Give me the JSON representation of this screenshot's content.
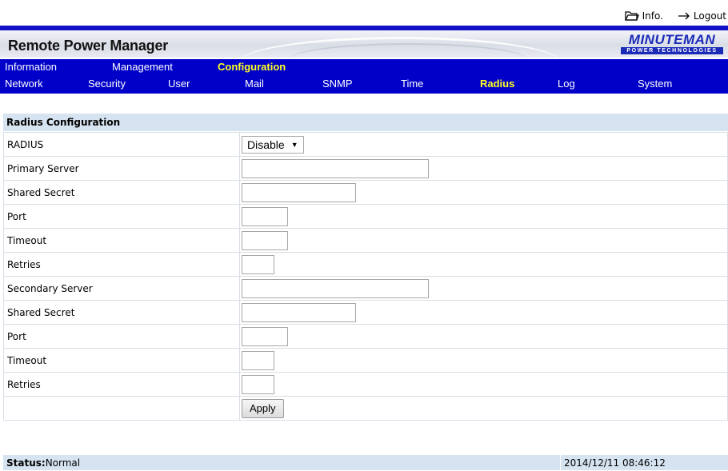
{
  "toplinks": {
    "info_label": "Info.",
    "logout_label": "Logout"
  },
  "app": {
    "title": "Remote Power Manager",
    "logo_main": "MINUTEMAN",
    "logo_sub": "POWER TECHNOLOGIES"
  },
  "nav_primary": [
    {
      "label": "Information",
      "active": false
    },
    {
      "label": "Management",
      "active": false
    },
    {
      "label": "Configuration",
      "active": true
    }
  ],
  "nav_secondary": [
    {
      "label": "Network",
      "active": false
    },
    {
      "label": "Security",
      "active": false
    },
    {
      "label": "User",
      "active": false
    },
    {
      "label": "Mail",
      "active": false
    },
    {
      "label": "SNMP",
      "active": false
    },
    {
      "label": "Time",
      "active": false
    },
    {
      "label": "Radius",
      "active": true
    },
    {
      "label": "Log",
      "active": false
    },
    {
      "label": "System",
      "active": false
    }
  ],
  "form": {
    "title": "Radius Configuration",
    "radius_label": "RADIUS",
    "radius_value": "Disable",
    "fields": [
      {
        "label": "Primary Server",
        "value": ""
      },
      {
        "label": "Shared Secret",
        "value": ""
      },
      {
        "label": "Port",
        "value": ""
      },
      {
        "label": "Timeout",
        "value": ""
      },
      {
        "label": "Retries",
        "value": ""
      },
      {
        "label": "Secondary Server",
        "value": ""
      },
      {
        "label": "Shared Secret",
        "value": ""
      },
      {
        "label": "Port",
        "value": ""
      },
      {
        "label": "Timeout",
        "value": ""
      },
      {
        "label": "Retries",
        "value": ""
      }
    ],
    "apply_label": "Apply"
  },
  "status": {
    "label": "Status:",
    "value": "Normal",
    "datetime": "2014/12/11 08:46:12"
  },
  "colors": {
    "nav_bg": "#0000c8",
    "nav_active": "#ffff22",
    "section_bg": "#d6e3f0"
  }
}
